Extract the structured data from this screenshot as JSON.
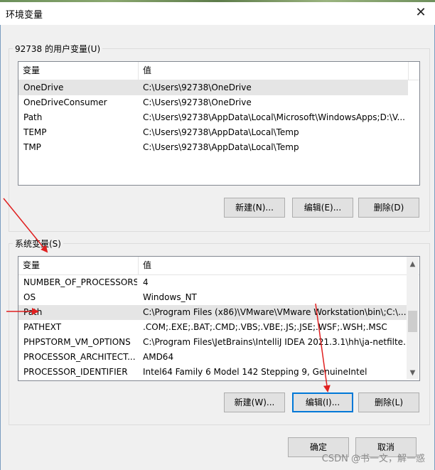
{
  "window": {
    "title": "环境变量",
    "close_glyph": "✕"
  },
  "user_vars": {
    "group_label": "92738 的用户变量(U)",
    "header": {
      "name": "变量",
      "value": "值"
    },
    "rows": [
      {
        "name": "OneDrive",
        "value": "C:\\Users\\92738\\OneDrive"
      },
      {
        "name": "OneDriveConsumer",
        "value": "C:\\Users\\92738\\OneDrive"
      },
      {
        "name": "Path",
        "value": "C:\\Users\\92738\\AppData\\Local\\Microsoft\\WindowsApps;D:\\V..."
      },
      {
        "name": "TEMP",
        "value": "C:\\Users\\92738\\AppData\\Local\\Temp"
      },
      {
        "name": "TMP",
        "value": "C:\\Users\\92738\\AppData\\Local\\Temp"
      }
    ],
    "buttons": {
      "new": "新建(N)...",
      "edit": "编辑(E)...",
      "delete": "删除(D)"
    }
  },
  "system_vars": {
    "group_label": "系统变量(S)",
    "header": {
      "name": "变量",
      "value": "值"
    },
    "rows": [
      {
        "name": "NUMBER_OF_PROCESSORS",
        "value": "4"
      },
      {
        "name": "OS",
        "value": "Windows_NT"
      },
      {
        "name": "Path",
        "value": "C:\\Program Files (x86)\\VMware\\VMware Workstation\\bin\\;C:\\..."
      },
      {
        "name": "PATHEXT",
        "value": ".COM;.EXE;.BAT;.CMD;.VBS;.VBE;.JS;.JSE;.WSF;.WSH;.MSC"
      },
      {
        "name": "PHPSTORM_VM_OPTIONS",
        "value": "C:\\Program Files\\JetBrains\\IntelliJ IDEA 2021.3.1\\hh\\ja-netfilte..."
      },
      {
        "name": "PROCESSOR_ARCHITECT...",
        "value": "AMD64"
      },
      {
        "name": "PROCESSOR_IDENTIFIER",
        "value": "Intel64 Family 6 Model 142 Stepping 9, GenuineIntel"
      }
    ],
    "buttons": {
      "new": "新建(W)...",
      "edit": "编辑(I)...",
      "delete": "删除(L)"
    }
  },
  "footer": {
    "ok": "确定",
    "cancel": "取消"
  },
  "watermark": "CSDN @书一文，解一惑",
  "colors": {
    "annotation_arrow": "#e02020",
    "focus": "#0078d7"
  }
}
